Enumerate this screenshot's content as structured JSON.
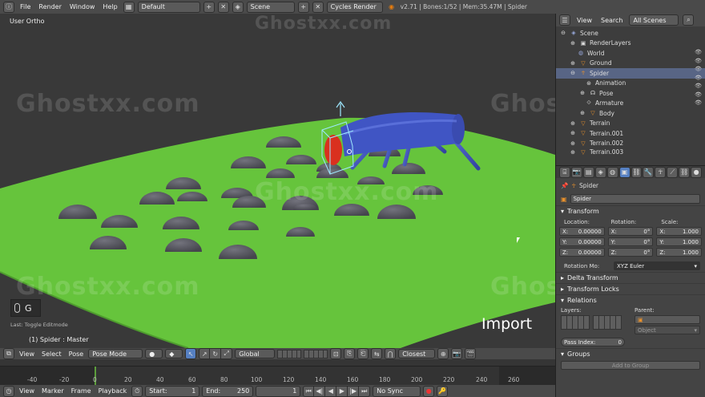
{
  "top_bar": {
    "menus": [
      "File",
      "Render",
      "Window",
      "Help"
    ],
    "screen_layout": "Default",
    "scene": "Scene",
    "engine": "Cycles Render",
    "stats": "v2.71 | Bones:1/52 | Mem:35.47M | Spider"
  },
  "viewport": {
    "label": "User Ortho",
    "key_hint": "G",
    "last_op": "Last: Toggle Editmode",
    "object_label": "(1) Spider : Master",
    "overlay_text": "Import"
  },
  "watermark": "Ghostxx.com",
  "view3d_header": {
    "menus": [
      "View",
      "Select",
      "Pose"
    ],
    "mode": "Pose Mode",
    "orientation": "Global",
    "snap": "Closest"
  },
  "timeline": {
    "ticks": [
      "-40",
      "-20",
      "0",
      "20",
      "40",
      "60",
      "80",
      "100",
      "120",
      "140",
      "160",
      "180",
      "200",
      "220",
      "240",
      "260"
    ],
    "menus": [
      "View",
      "Marker",
      "Frame",
      "Playback"
    ],
    "start_label": "Start:",
    "start_value": "1",
    "end_label": "End:",
    "end_value": "250",
    "current": "1",
    "sync": "No Sync"
  },
  "outliner": {
    "menu": "View",
    "search": "Search",
    "filter": "All Scenes",
    "rows": [
      {
        "label": "Scene",
        "indent": 0
      },
      {
        "label": "RenderLayers",
        "indent": 1
      },
      {
        "label": "World",
        "indent": 1
      },
      {
        "label": "Ground",
        "indent": 1
      },
      {
        "label": "Spider",
        "indent": 1
      },
      {
        "label": "Animation",
        "indent": 2
      },
      {
        "label": "Pose",
        "indent": 2
      },
      {
        "label": "Armature",
        "indent": 2
      },
      {
        "label": "Body",
        "indent": 2
      },
      {
        "label": "Terrain",
        "indent": 1
      },
      {
        "label": "Terrain.001",
        "indent": 1
      },
      {
        "label": "Terrain.002",
        "indent": 1
      },
      {
        "label": "Terrain.003",
        "indent": 1
      }
    ]
  },
  "properties": {
    "object_name": "Spider",
    "breadcrumb": "Spider",
    "transform_title": "Transform",
    "location_label": "Location:",
    "rotation_label": "Rotation:",
    "scale_label": "Scale:",
    "location": [
      "0.00000",
      "0.00000",
      "0.00000"
    ],
    "rotation": [
      "0°",
      "0°",
      "0°"
    ],
    "scale": [
      "1.000",
      "1.000",
      "1.000"
    ],
    "axes": [
      "X:",
      "Y:",
      "Z:"
    ],
    "rotation_mode_label": "Rotation Mo:",
    "rotation_mode": "XYZ Euler",
    "delta_transform": "Delta Transform",
    "transform_locks": "Transform Locks",
    "relations": "Relations",
    "layers_label": "Layers:",
    "parent_label": "Parent:",
    "parent_type": "Object",
    "pass_index_label": "Pass Index:",
    "pass_index": "0",
    "groups": "Groups",
    "add_to_group": "Add to Group"
  }
}
